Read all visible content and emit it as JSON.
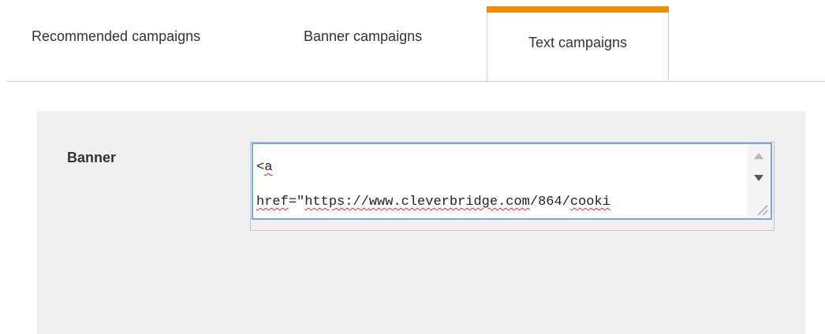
{
  "tabs": [
    {
      "label": "Recommended campaigns",
      "active": false
    },
    {
      "label": "Banner campaigns",
      "active": false
    },
    {
      "label": "Text campaigns",
      "active": true
    }
  ],
  "colors": {
    "accent": "#f28a00",
    "panel_bg": "#f0f0f0",
    "focus_border": "#7fa5e0"
  },
  "form": {
    "banner_label": "Banner",
    "banner_code": {
      "line1_prefix": "<",
      "line1_word": "a",
      "line2_word": "href",
      "line2_eq": "=\"",
      "line2_scheme": "https://",
      "line2_domain": "www.cleverbridge.com",
      "line2_path": "/864/",
      "line2_tail": "cooki"
    }
  },
  "icons": {
    "scroll_up": "triangle-up-icon",
    "scroll_down": "triangle-down-icon",
    "resize": "resize-grip-icon"
  }
}
